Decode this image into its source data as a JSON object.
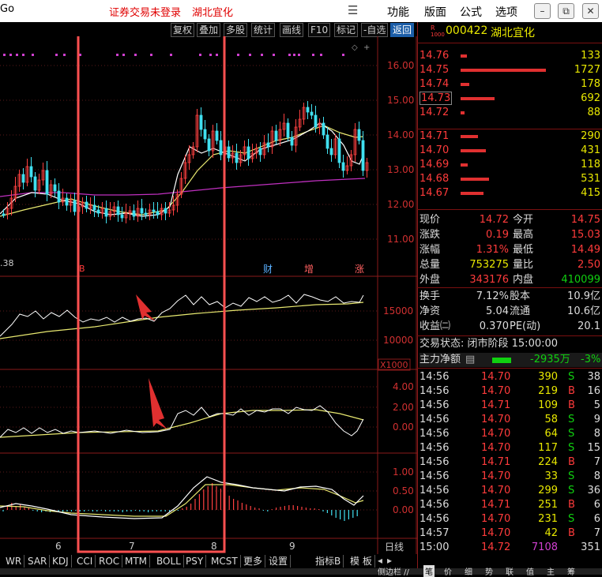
{
  "titlebar": {
    "left_text": "Go",
    "status": "证券交易未登录",
    "stock_name": "湖北宜化",
    "menus": [
      "功能",
      "版面",
      "公式",
      "选项"
    ]
  },
  "toolbar": {
    "buttons": [
      "复权",
      "叠加",
      "多股",
      "统计",
      "画线",
      "F10",
      "标记",
      "-自选",
      "返回"
    ]
  },
  "price_axis": [
    "16.00",
    "15.00",
    "14.00",
    "13.00",
    "12.00",
    "11.00"
  ],
  "volume_axis": [
    "15000",
    "10000"
  ],
  "volume_unit": "X1000",
  "macd_axis_1": [
    "4.00",
    "2.00",
    "0.00"
  ],
  "macd_axis_2": [
    "1.00",
    "0.50",
    "0.00"
  ],
  "chart_tags": {
    "left_value": ".38",
    "cai": "财",
    "zeng": "增",
    "zhang": "涨",
    "marker_b": "B"
  },
  "date_labels": [
    "6",
    "7",
    "8",
    "9"
  ],
  "bottom_tabs": [
    "WR",
    "SAR",
    "KDJ",
    "CCI",
    "ROC",
    "MTM",
    "BOLL",
    "PSY",
    "MCST",
    "更多",
    "设置"
  ],
  "bottom_right": {
    "indicator": "指标B",
    "template": "模 板",
    "daily": "日线"
  },
  "bottom_strip": [
    "侧边栏 //",
    "笔",
    "价",
    "细",
    "势",
    "联",
    "值",
    "主",
    "筹"
  ],
  "quote": {
    "code_prefix": "R",
    "code_sub": "1000",
    "code": "000422",
    "name": "湖北宜化",
    "sell": [
      {
        "price": "14.76",
        "volume": "133",
        "bar": 0.07
      },
      {
        "price": "14.75",
        "volume": "1727",
        "bar": 1.0
      },
      {
        "price": "14.74",
        "volume": "178",
        "bar": 0.1
      },
      {
        "price": "14.73",
        "volume": "692",
        "bar": 0.4
      },
      {
        "price": "14.72",
        "volume": "88",
        "bar": 0.05
      }
    ],
    "buy": [
      {
        "price": "14.71",
        "volume": "290",
        "bar": 0.2
      },
      {
        "price": "14.70",
        "volume": "431",
        "bar": 0.3
      },
      {
        "price": "14.69",
        "volume": "118",
        "bar": 0.08
      },
      {
        "price": "14.68",
        "volume": "531",
        "bar": 0.33
      },
      {
        "price": "14.67",
        "volume": "415",
        "bar": 0.27
      }
    ],
    "stats": [
      {
        "l1": "现价",
        "v1": "14.72",
        "c1": "red",
        "l2": "今开",
        "v2": "14.75",
        "c2": "red"
      },
      {
        "l1": "涨跌",
        "v1": "0.19",
        "c1": "red",
        "l2": "最高",
        "v2": "15.03",
        "c2": "red"
      },
      {
        "l1": "涨幅",
        "v1": "1.31%",
        "c1": "red",
        "l2": "最低",
        "v2": "14.49",
        "c2": "red"
      },
      {
        "l1": "总量",
        "v1": "753275",
        "c1": "yellow",
        "l2": "量比",
        "v2": "2.50",
        "c2": "red"
      },
      {
        "l1": "外盘",
        "v1": "343176",
        "c1": "red",
        "l2": "内盘",
        "v2": "410099",
        "c2": "green"
      }
    ],
    "stats2": [
      {
        "l1": "换手",
        "v1": "7.12%",
        "l2": "股本",
        "v2": "10.9亿"
      },
      {
        "l1": "净资",
        "v1": "5.04",
        "l2": "流通",
        "v2": "10.6亿"
      },
      {
        "l1": "收益㈡",
        "v1": "0.370",
        "l2": "PE(动)",
        "v2": "20.1"
      }
    ],
    "trade_state": "交易状态: 闭市阶段 15:00:00",
    "main_flow_label": "主力净额",
    "main_flow_value": "-2935万",
    "main_flow_pct": "-3%",
    "ticks": [
      {
        "t": "14:56",
        "p": "14.70",
        "v": "390",
        "s": "S",
        "n": "38"
      },
      {
        "t": "14:56",
        "p": "14.70",
        "v": "219",
        "s": "B",
        "n": "16"
      },
      {
        "t": "14:56",
        "p": "14.71",
        "v": "109",
        "s": "B",
        "n": "5"
      },
      {
        "t": "14:56",
        "p": "14.70",
        "v": "58",
        "s": "S",
        "n": "9"
      },
      {
        "t": "14:56",
        "p": "14.70",
        "v": "64",
        "s": "S",
        "n": "8"
      },
      {
        "t": "14:56",
        "p": "14.70",
        "v": "117",
        "s": "S",
        "n": "15"
      },
      {
        "t": "14:56",
        "p": "14.71",
        "v": "224",
        "s": "B",
        "n": "7"
      },
      {
        "t": "14:56",
        "p": "14.70",
        "v": "33",
        "s": "S",
        "n": "8"
      },
      {
        "t": "14:56",
        "p": "14.70",
        "v": "299",
        "s": "S",
        "n": "36"
      },
      {
        "t": "14:56",
        "p": "14.71",
        "v": "251",
        "s": "B",
        "n": "6"
      },
      {
        "t": "14:56",
        "p": "14.70",
        "v": "231",
        "s": "S",
        "n": "6"
      },
      {
        "t": "14:57",
        "p": "14.70",
        "v": "42",
        "s": "B",
        "n": "7"
      },
      {
        "t": "15:00",
        "p": "14.72",
        "v": "7108",
        "s": "",
        "n": "351"
      }
    ]
  }
}
